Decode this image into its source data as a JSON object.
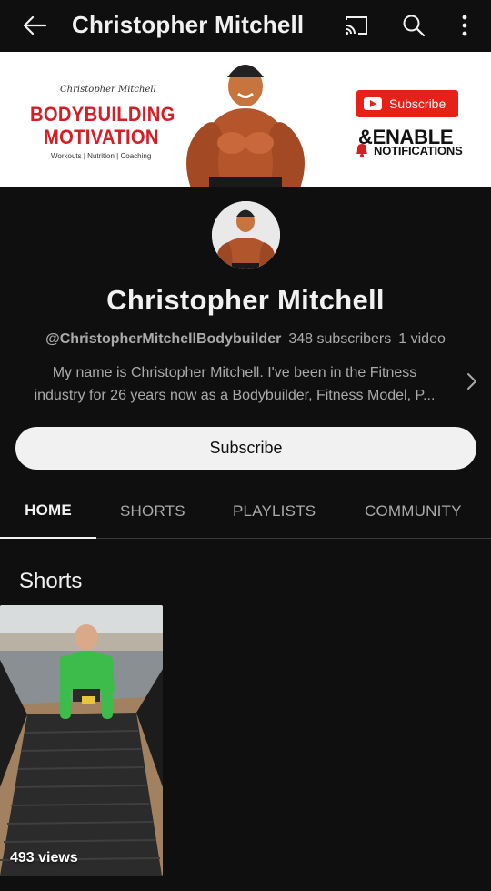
{
  "topbar": {
    "title": "Christopher Mitchell",
    "icons": [
      "arrow-left-icon",
      "cast-icon",
      "search-icon",
      "more-vertical-icon"
    ]
  },
  "banner": {
    "script_text": "Christopher Mitchell",
    "title_line1": "BODYBUILDING",
    "title_line2": "MOTIVATION",
    "tagline": "Workouts | Nutrition | Coaching",
    "subscribe_label": "Subscribe",
    "enable_text": "&ENABLE",
    "notifications_text": "NOTIFICATIONS",
    "accent_color": "#d51f26"
  },
  "channel": {
    "name": "Christopher Mitchell",
    "handle": "@ChristopherMitchellBodybuilder",
    "subscribers": "348 subscribers",
    "videos": "1 video",
    "description_line1": "My name is Christopher Mitchell. I've been in the Fitness",
    "description_line2": "industry for 26 years now as a Bodybuilder, Fitness Model, P..."
  },
  "subscribe_button": {
    "label": "Subscribe"
  },
  "tabs": [
    {
      "label": "HOME",
      "active": true
    },
    {
      "label": "SHORTS",
      "active": false
    },
    {
      "label": "PLAYLISTS",
      "active": false
    },
    {
      "label": "COMMUNITY",
      "active": false
    }
  ],
  "shorts_section": {
    "title": "Shorts",
    "items": [
      {
        "views": "493 views"
      }
    ]
  },
  "colors": {
    "background": "#0f0f0f",
    "text_primary": "#f1f1f1",
    "text_secondary": "#aaaaaa",
    "button_bg": "#f1f1f1"
  }
}
